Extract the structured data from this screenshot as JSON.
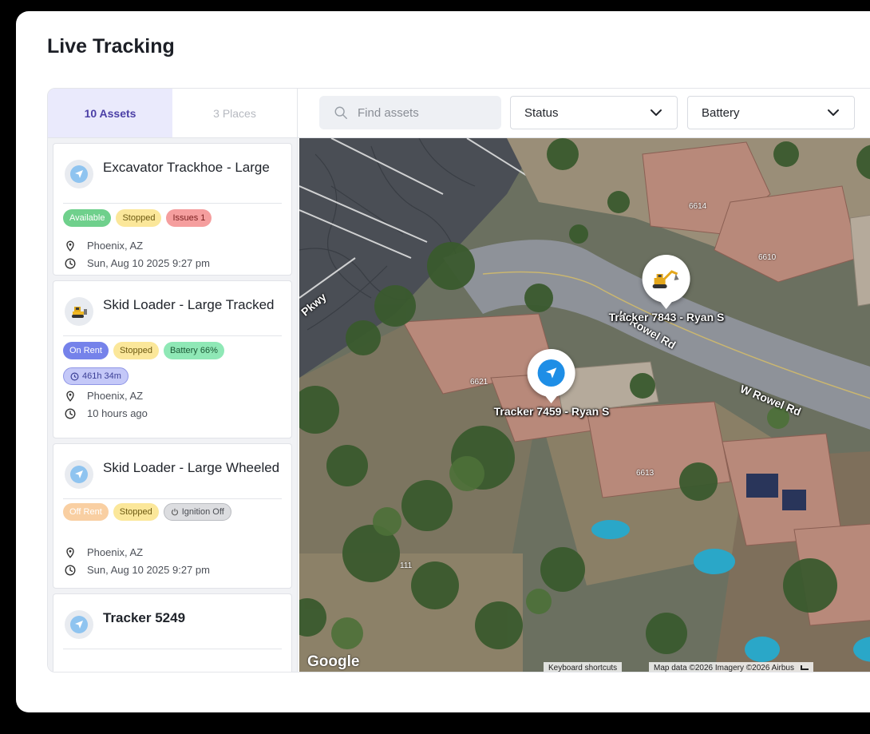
{
  "page": {
    "title": "Live Tracking"
  },
  "tabs": [
    {
      "label": "10 Assets",
      "active": true
    },
    {
      "label": "3 Places",
      "active": false
    }
  ],
  "toolbar": {
    "search_placeholder": "Find assets",
    "status_label": "Status",
    "battery_label": "Battery"
  },
  "assets": [
    {
      "name": "Excavator Trackhoe - Large",
      "icon": "navigation-arrow-icon",
      "badges": [
        "Available",
        "Stopped",
        "Issues 1"
      ],
      "location": "Phoenix, AZ",
      "time": "Sun, Aug 10 2025 9:27 pm"
    },
    {
      "name": "Skid Loader - Large Tracked",
      "icon": "bulldozer-icon",
      "badges": [
        "On Rent",
        "Stopped",
        "Battery 66%"
      ],
      "duration": "461h 34m",
      "location": "Phoenix, AZ",
      "time": "10 hours ago"
    },
    {
      "name": "Skid Loader - Large Wheeled",
      "icon": "navigation-arrow-icon",
      "badges": [
        "Off Rent",
        "Stopped",
        "Ignition Off"
      ],
      "location": "Phoenix, AZ",
      "time": "Sun, Aug 10 2025 9:27 pm"
    },
    {
      "name": "Tracker 5249",
      "icon": "navigation-arrow-icon"
    }
  ],
  "map": {
    "markers": [
      {
        "label": "Tracker 7843 - Ryan S",
        "icon": "excavator-icon"
      },
      {
        "label": "Tracker 7459 - Ryan S",
        "icon": "navigation-arrow-icon"
      }
    ],
    "roads": [
      "Pkwy",
      "W Rowel Rd",
      "W Rowel Rd"
    ],
    "house_numbers": [
      "6614",
      "6610",
      "6621",
      "6613",
      "111"
    ],
    "logo": "Google",
    "keyboard_shortcuts": "Keyboard shortcuts",
    "attribution": "Map data ©2026 Imagery ©2026 Airbus"
  },
  "colors": {
    "accent": "#4b3fa6",
    "active_tab_bg": "#eaeafc",
    "marker_blue": "#1e8ee6"
  }
}
